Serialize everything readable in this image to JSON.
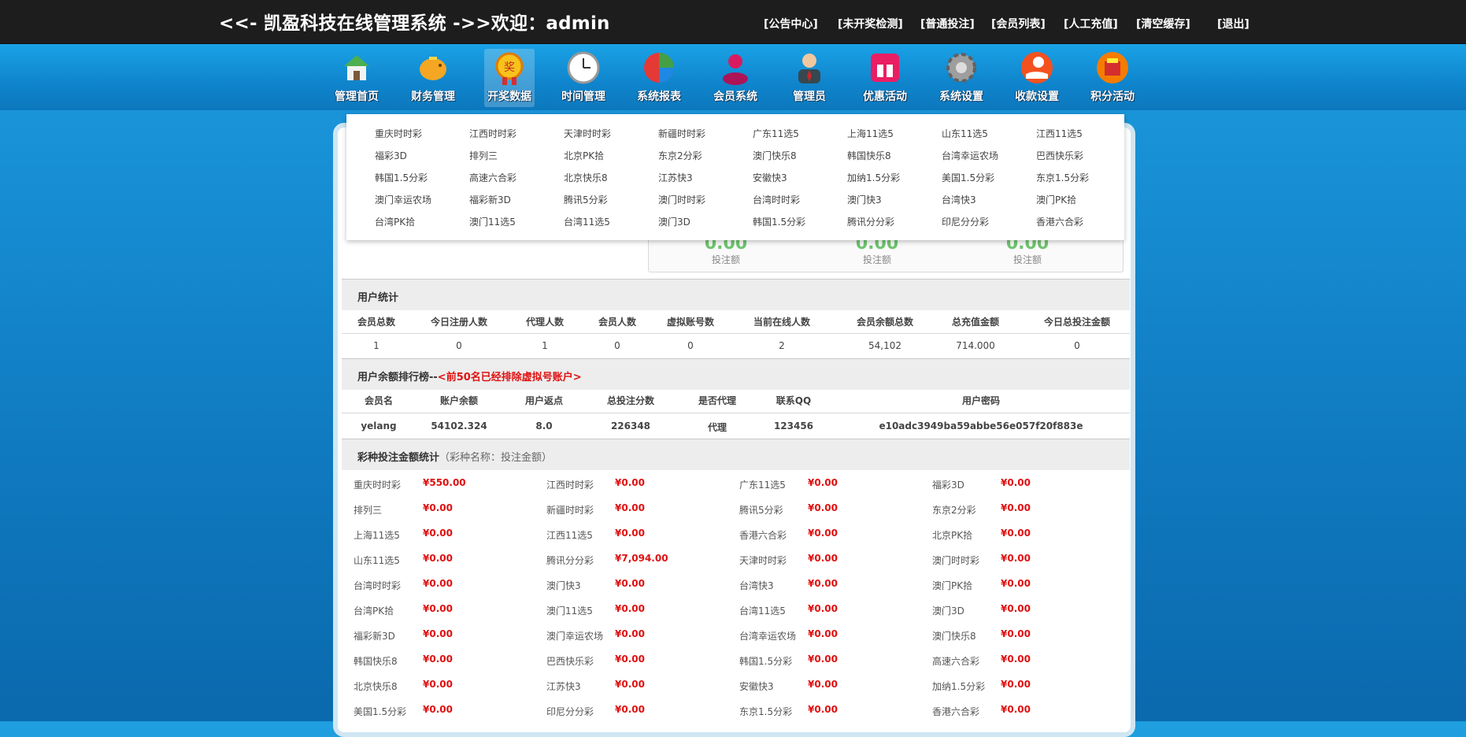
{
  "header": {
    "title": "<<- 凯盈科技在线管理系统 ->>欢迎：admin",
    "links": [
      "[公告中心]",
      "[未开奖检测]",
      "[普通投注]",
      "[会员列表]",
      "[人工充值]",
      "[清空缓存]",
      "[退出]"
    ]
  },
  "nav": {
    "items": [
      {
        "label": "管理首页",
        "icon": "home-icon"
      },
      {
        "label": "财务管理",
        "icon": "piggy-bank-icon"
      },
      {
        "label": "开奖数据",
        "icon": "lottery-medal-icon"
      },
      {
        "label": "时间管理",
        "icon": "clock-icon"
      },
      {
        "label": "系统报表",
        "icon": "pie-chart-icon"
      },
      {
        "label": "会员系统",
        "icon": "members-icon"
      },
      {
        "label": "管理员",
        "icon": "admin-user-icon"
      },
      {
        "label": "优惠活动",
        "icon": "gift-icon"
      },
      {
        "label": "系统设置",
        "icon": "gear-icon"
      },
      {
        "label": "收款设置",
        "icon": "money-hand-icon"
      },
      {
        "label": "积分活动",
        "icon": "points-gift-icon"
      }
    ],
    "active_index": 2
  },
  "dropdown": {
    "rows": [
      [
        "重庆时时彩",
        "江西时时彩",
        "天津时时彩",
        "新疆时时彩",
        "广东11选5",
        "上海11选5",
        "山东11选5",
        "江西11选5"
      ],
      [
        "福彩3D",
        "排列三",
        "北京PK拾",
        "东京2分彩",
        "澳门快乐8",
        "韩国快乐8",
        "台湾幸运农场",
        "巴西快乐彩"
      ],
      [
        "韩国1.5分彩",
        "高速六合彩",
        "北京快乐8",
        "江苏快3",
        "安徽快3",
        "加纳1.5分彩",
        "美国1.5分彩",
        "东京1.5分彩"
      ],
      [
        "澳门幸运农场",
        "福彩新3D",
        "腾讯5分彩",
        "澳门时时彩",
        "台湾时时彩",
        "澳门快3",
        "台湾快3",
        "澳门PK拾"
      ],
      [
        "台湾PK拾",
        "澳门11选5",
        "台湾11选5",
        "澳门3D",
        "韩国1.5分彩",
        "腾讯分分彩",
        "印尼分分彩",
        "香港六合彩"
      ]
    ]
  },
  "bet_summary": {
    "items": [
      {
        "value": "0.00",
        "label": "投注额"
      },
      {
        "value": "0.00",
        "label": "投注额"
      },
      {
        "value": "0.00",
        "label": "投注额"
      }
    ]
  },
  "user_stats": {
    "title": "用户统计",
    "headers": [
      "会员总数",
      "今日注册人数",
      "代理人数",
      "会员人数",
      "虚拟账号数",
      "当前在线人数",
      "会员余额总数",
      "总充值金额",
      "今日总投注金额"
    ],
    "values": [
      "1",
      "0",
      "1",
      "0",
      "0",
      "2",
      "54,102",
      "714.000",
      "0"
    ]
  },
  "balance_rank": {
    "title": "用户余额排行榜--",
    "note": "<前50名已经排除虚拟号账户>",
    "headers": [
      "会员名",
      "账户余额",
      "用户返点",
      "总投注分数",
      "是否代理",
      "联系QQ",
      "用户密码"
    ],
    "rows": [
      [
        "yelang",
        "54102.324",
        "8.0",
        "226348",
        "代理",
        "123456",
        "e10adc3949ba59abbe56e057f20f883e"
      ]
    ]
  },
  "lottery_bets": {
    "title": "彩种投注金额统计",
    "subtitle": "（彩种名称：投注金额）",
    "rows": [
      [
        [
          "重庆时时彩",
          "¥550.00"
        ],
        [
          "江西时时彩",
          "¥0.00"
        ],
        [
          "广东11选5",
          "¥0.00"
        ],
        [
          "福彩3D",
          "¥0.00"
        ]
      ],
      [
        [
          "排列三",
          "¥0.00"
        ],
        [
          "新疆时时彩",
          "¥0.00"
        ],
        [
          "腾讯5分彩",
          "¥0.00"
        ],
        [
          "东京2分彩",
          "¥0.00"
        ]
      ],
      [
        [
          "上海11选5",
          "¥0.00"
        ],
        [
          "江西11选5",
          "¥0.00"
        ],
        [
          "香港六合彩",
          "¥0.00"
        ],
        [
          "北京PK拾",
          "¥0.00"
        ]
      ],
      [
        [
          "山东11选5",
          "¥0.00"
        ],
        [
          "腾讯分分彩",
          "¥7,094.00"
        ],
        [
          "天津时时彩",
          "¥0.00"
        ],
        [
          "澳门时时彩",
          "¥0.00"
        ]
      ],
      [
        [
          "台湾时时彩",
          "¥0.00"
        ],
        [
          "澳门快3",
          "¥0.00"
        ],
        [
          "台湾快3",
          "¥0.00"
        ],
        [
          "澳门PK拾",
          "¥0.00"
        ]
      ],
      [
        [
          "台湾PK拾",
          "¥0.00"
        ],
        [
          "澳门11选5",
          "¥0.00"
        ],
        [
          "台湾11选5",
          "¥0.00"
        ],
        [
          "澳门3D",
          "¥0.00"
        ]
      ],
      [
        [
          "福彩新3D",
          "¥0.00"
        ],
        [
          "澳门幸运农场",
          "¥0.00"
        ],
        [
          "台湾幸运农场",
          "¥0.00"
        ],
        [
          "澳门快乐8",
          "¥0.00"
        ]
      ],
      [
        [
          "韩国快乐8",
          "¥0.00"
        ],
        [
          "巴西快乐彩",
          "¥0.00"
        ],
        [
          "韩国1.5分彩",
          "¥0.00"
        ],
        [
          "高速六合彩",
          "¥0.00"
        ]
      ],
      [
        [
          "北京快乐8",
          "¥0.00"
        ],
        [
          "江苏快3",
          "¥0.00"
        ],
        [
          "安徽快3",
          "¥0.00"
        ],
        [
          "加纳1.5分彩",
          "¥0.00"
        ]
      ],
      [
        [
          "美国1.5分彩",
          "¥0.00"
        ],
        [
          "印尼分分彩",
          "¥0.00"
        ],
        [
          "东京1.5分彩",
          "¥0.00"
        ],
        [
          "香港六合彩",
          "¥0.00"
        ]
      ]
    ]
  },
  "colors": {
    "accent_red": "#e01010",
    "stat_green": "#6ec46e",
    "topbar_bg": "#1d1d1d"
  }
}
